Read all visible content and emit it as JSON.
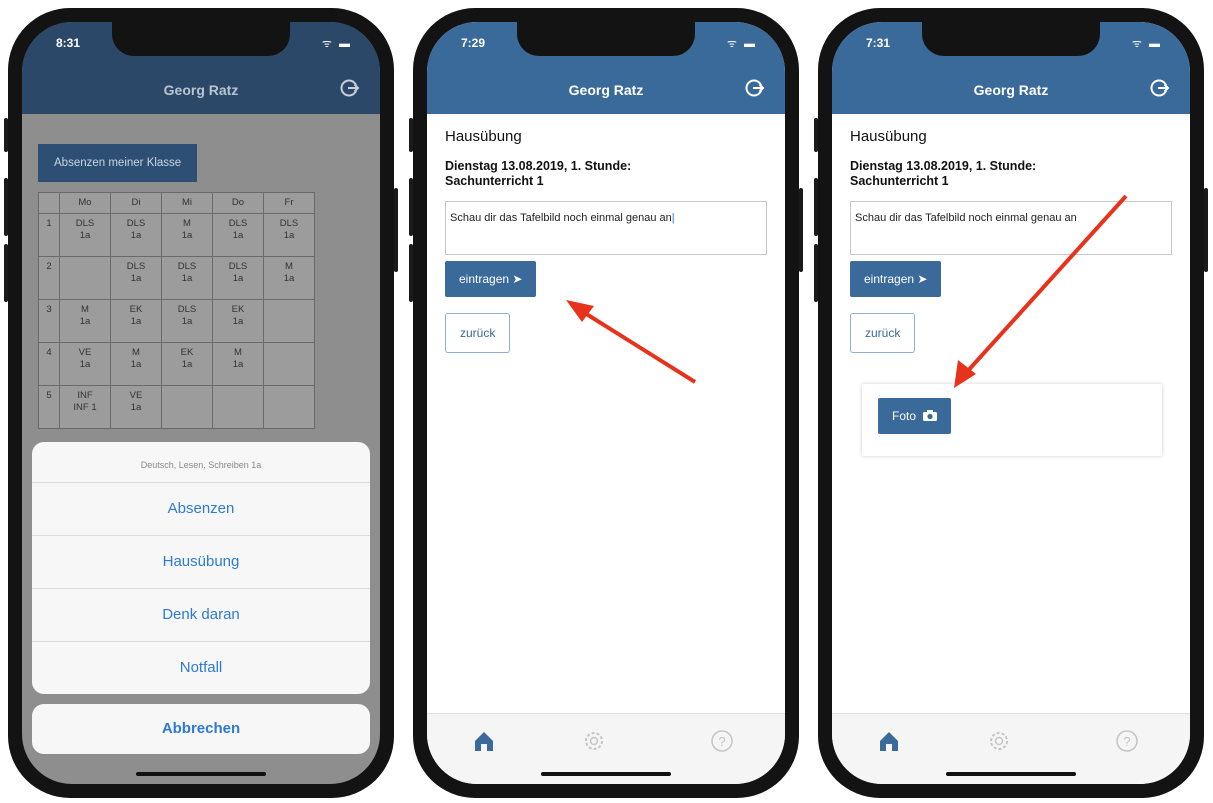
{
  "phone1": {
    "time": "8:31",
    "user_name": "Georg Ratz",
    "class_absences_button": "Absenzen meiner Klasse",
    "timetable": {
      "days": [
        "Mo",
        "Di",
        "Mi",
        "Do",
        "Fr"
      ],
      "rows": [
        {
          "period": "1",
          "cells": [
            [
              "DLS",
              "1a"
            ],
            [
              "DLS",
              "1a"
            ],
            [
              "M",
              "1a"
            ],
            [
              "DLS",
              "1a"
            ],
            [
              "DLS",
              "1a"
            ]
          ]
        },
        {
          "period": "2",
          "cells": [
            [
              "",
              ""
            ],
            [
              "DLS",
              "1a"
            ],
            [
              "DLS",
              "1a"
            ],
            [
              "DLS",
              "1a"
            ],
            [
              "M",
              "1a"
            ]
          ]
        },
        {
          "period": "3",
          "cells": [
            [
              "M",
              "1a"
            ],
            [
              "EK",
              "1a"
            ],
            [
              "DLS",
              "1a"
            ],
            [
              "EK",
              "1a"
            ],
            [
              "",
              ""
            ]
          ]
        },
        {
          "period": "4",
          "cells": [
            [
              "VE",
              "1a"
            ],
            [
              "M",
              "1a"
            ],
            [
              "EK",
              "1a"
            ],
            [
              "M",
              "1a"
            ],
            [
              "",
              ""
            ]
          ]
        },
        {
          "period": "5",
          "cells": [
            [
              "INF",
              "INF 1"
            ],
            [
              "VE",
              "1a"
            ],
            [
              "",
              ""
            ],
            [
              "",
              ""
            ],
            [
              "",
              ""
            ]
          ]
        }
      ]
    },
    "action_sheet": {
      "caption": "Deutsch, Lesen, Schreiben 1a",
      "options": [
        "Absenzen",
        "Hausübung",
        "Denk daran",
        "Notfall"
      ],
      "cancel": "Abbrechen"
    }
  },
  "phone2": {
    "time": "7:29",
    "user_name": "Georg Ratz",
    "heading": "Hausübung",
    "lesson_line1": "Dienstag 13.08.2019, 1. Stunde:",
    "lesson_line2": "Sachunterricht 1",
    "homework_text": "Schau dir das Tafelbild noch einmal genau an",
    "submit_button": "eintragen",
    "back_button": "zurück"
  },
  "phone3": {
    "time": "7:31",
    "user_name": "Georg Ratz",
    "heading": "Hausübung",
    "lesson_line1": "Dienstag 13.08.2019, 1. Stunde:",
    "lesson_line2": "Sachunterricht 1",
    "homework_text": "Schau dir das Tafelbild noch einmal genau an",
    "submit_button": "eintragen",
    "back_button": "zurück",
    "photo_button": "Foto"
  },
  "colors": {
    "nav_blue": "#3a6a99",
    "link_blue": "#2d7ad1",
    "arrow_red": "#e8331c"
  },
  "icons": {
    "logout": "logout-icon",
    "send": "paper-plane-icon",
    "camera": "camera-icon",
    "tabs": [
      "home-icon",
      "gear-icon",
      "help-icon"
    ]
  }
}
